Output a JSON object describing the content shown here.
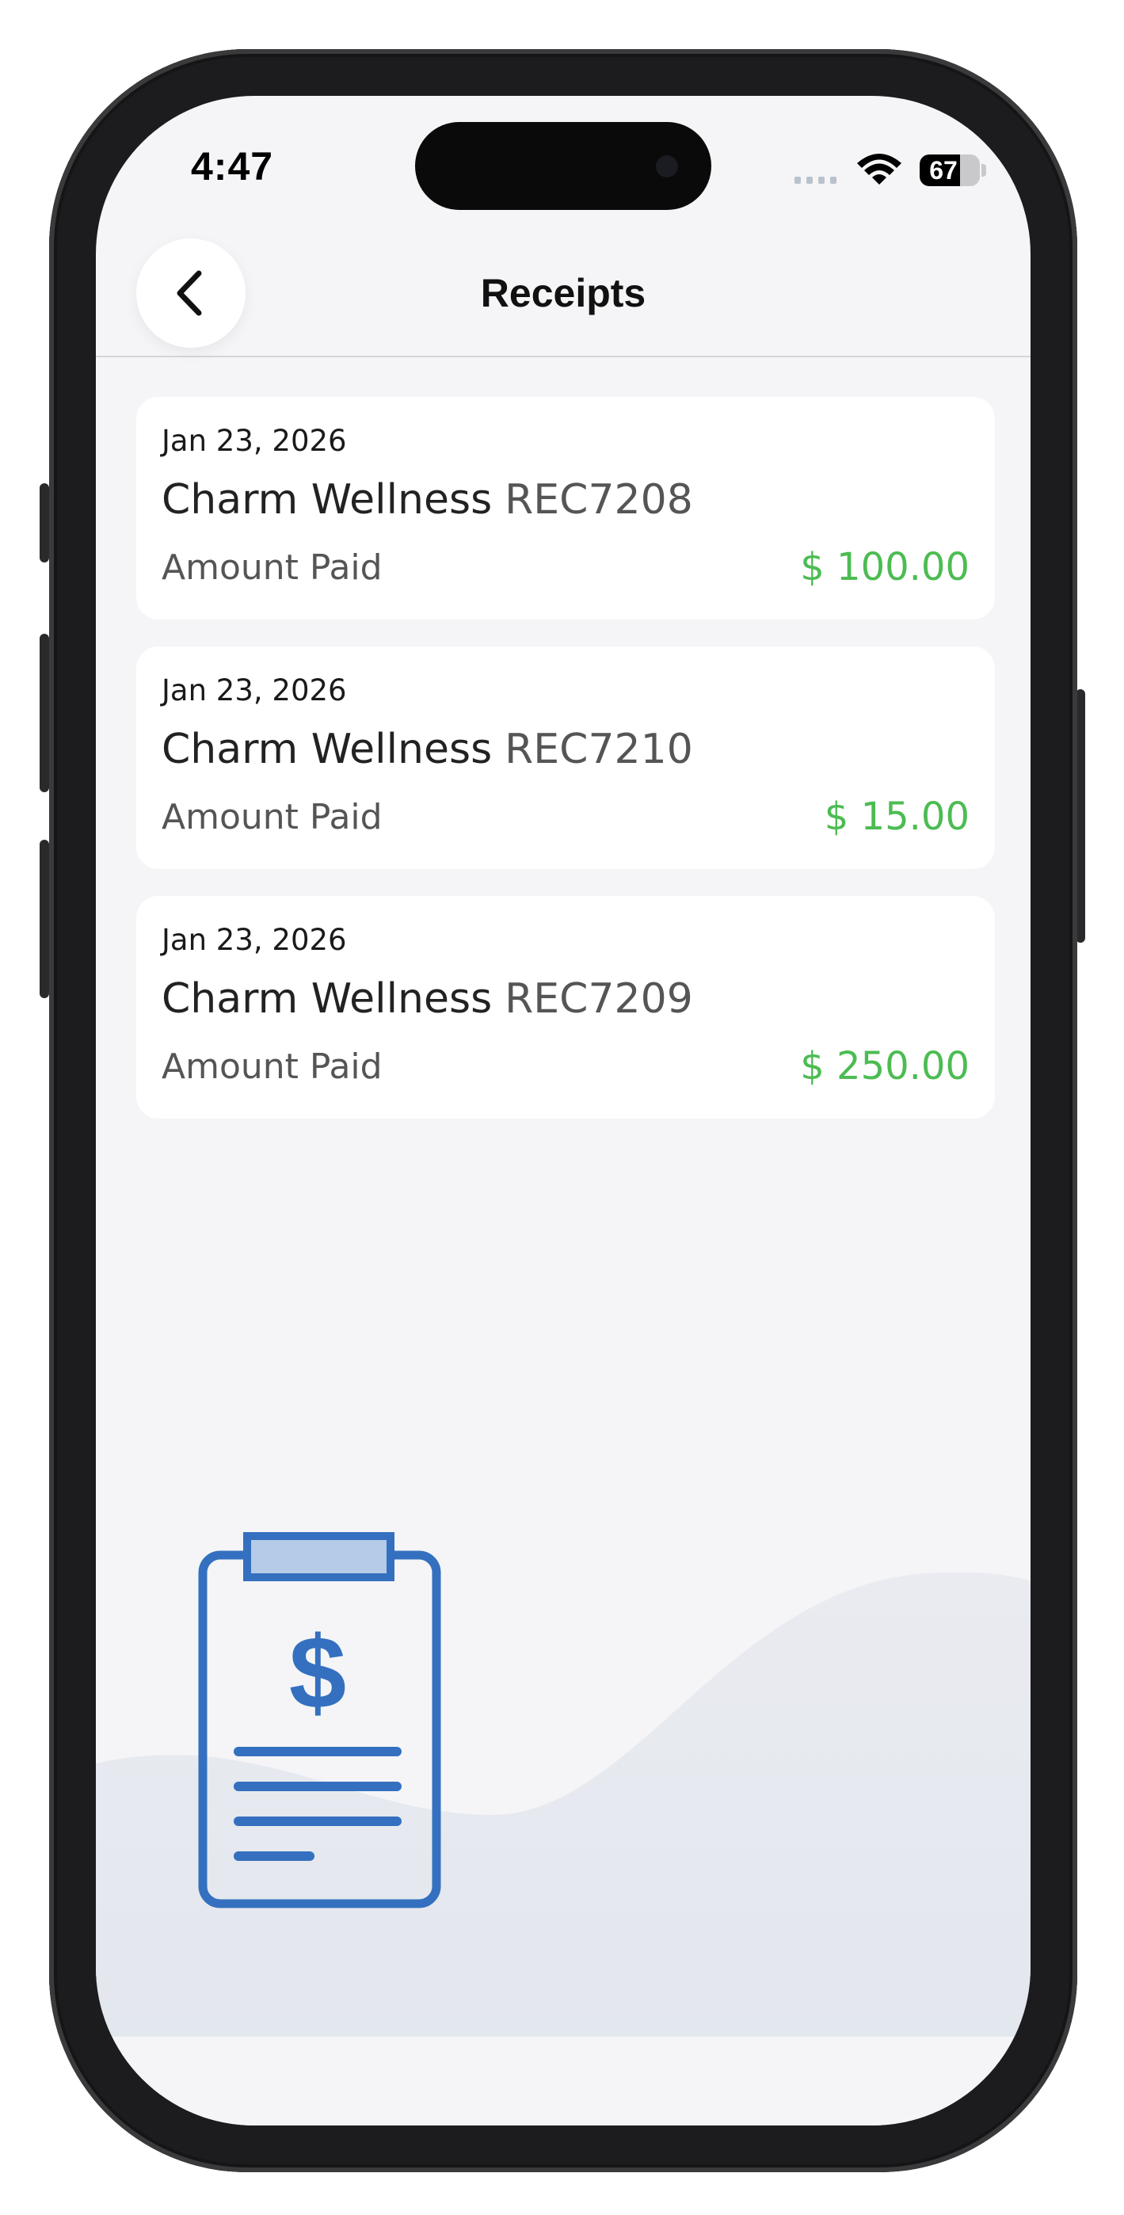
{
  "status_bar": {
    "time": "4:47",
    "battery_level": "67",
    "battery_fraction": 0.67
  },
  "header": {
    "title": "Receipts"
  },
  "receipts": [
    {
      "date": "Jan 23, 2026",
      "merchant": "Charm Wellness",
      "reference": "REC7208",
      "amount_label": "Amount Paid",
      "amount": "$ 100.00"
    },
    {
      "date": "Jan 23, 2026",
      "merchant": "Charm Wellness",
      "reference": "REC7210",
      "amount_label": "Amount Paid",
      "amount": "$ 15.00"
    },
    {
      "date": "Jan 23, 2026",
      "merchant": "Charm Wellness",
      "reference": "REC7209",
      "amount_label": "Amount Paid",
      "amount": "$ 250.00"
    }
  ],
  "illustration": {
    "icon": "receipt-clipboard-icon",
    "symbol": "$"
  },
  "colors": {
    "amount_green": "#4cbc52",
    "illustration_blue": "#3470bf",
    "background": "#f5f5f7"
  }
}
